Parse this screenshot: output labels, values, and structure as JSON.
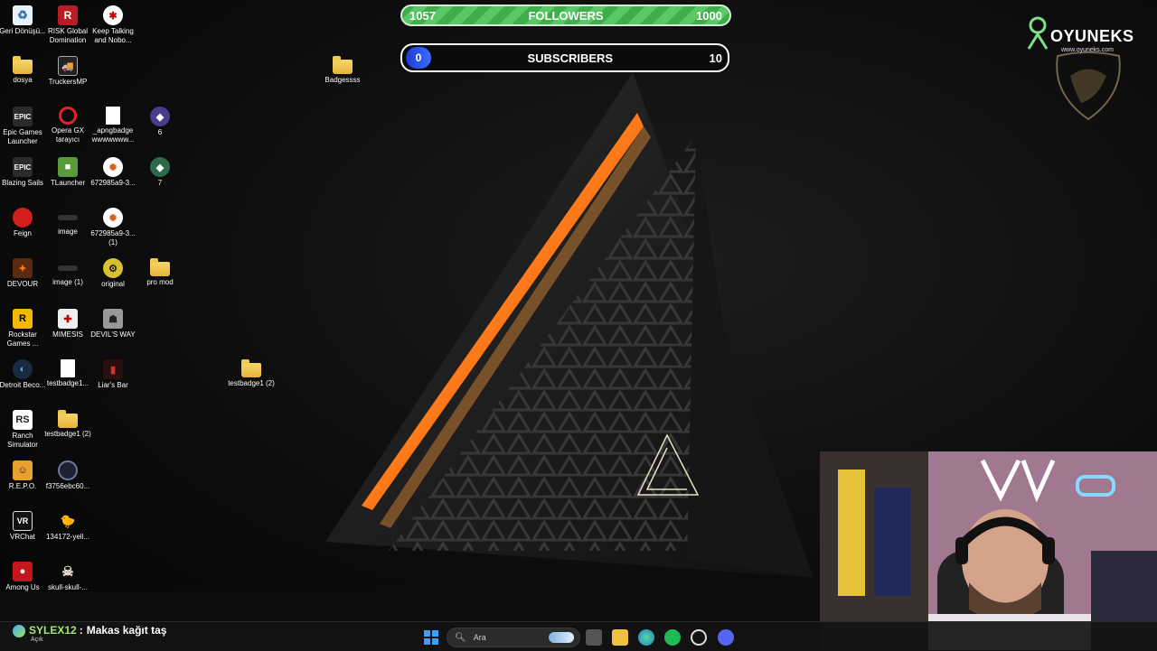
{
  "stream": {
    "followers": {
      "current": "1057",
      "label": "FOLLOWERS",
      "goal": "1000",
      "progress": 1.0,
      "color": "#4fbf5a"
    },
    "subscribers": {
      "current": "0",
      "label": "SUBSCRIBERS",
      "goal": "10",
      "progress": 0.0,
      "color": "#2a50f0"
    }
  },
  "brand": {
    "name": "OYUNEKS",
    "url": "www.oyuneks.com"
  },
  "desktop": {
    "icons": [
      {
        "label": "Geri Dönüşü...",
        "icon": "recycle-bin-icon"
      },
      {
        "label": "RISK Global Domination",
        "icon": "risk-icon"
      },
      {
        "label": "Keep Talking and Nobo...",
        "icon": "ktane-icon"
      },
      {
        "label": "dosya",
        "icon": "folder-icon"
      },
      {
        "label": "TruckersMP",
        "icon": "truck-icon"
      },
      {
        "label": "Badgessss",
        "icon": "folder-icon"
      },
      {
        "label": "Epic Games Launcher",
        "icon": "epic-icon"
      },
      {
        "label": "Opera GX tarayıcı",
        "icon": "opera-icon"
      },
      {
        "label": "_apngbadge wwwwwww...",
        "icon": "file-icon"
      },
      {
        "label": "6",
        "icon": "badge-icon"
      },
      {
        "label": "Blazing Sails",
        "icon": "epic-icon"
      },
      {
        "label": "TLauncher",
        "icon": "minecraft-icon"
      },
      {
        "label": "672985a9-3...",
        "icon": "gear-icon"
      },
      {
        "label": "7",
        "icon": "badge-icon"
      },
      {
        "label": "Feign",
        "icon": "feign-icon"
      },
      {
        "label": "image",
        "icon": "image-icon"
      },
      {
        "label": "672985a9-3... (1)",
        "icon": "gear-icon"
      },
      {
        "label": "DEVOUR",
        "icon": "devour-icon"
      },
      {
        "label": "image (1)",
        "icon": "image-icon"
      },
      {
        "label": "original",
        "icon": "original-icon"
      },
      {
        "label": "pro mod",
        "icon": "folder-icon"
      },
      {
        "label": "Rockstar Games ...",
        "icon": "rockstar-icon"
      },
      {
        "label": "MIMESIS",
        "icon": "mimesis-icon"
      },
      {
        "label": "DEVIL'S WAY",
        "icon": "devil-icon"
      },
      {
        "label": "Detroit Beco...",
        "icon": "detroit-icon"
      },
      {
        "label": "testbadge1...",
        "icon": "file-icon"
      },
      {
        "label": "Liar's Bar",
        "icon": "liars-bar-icon"
      },
      {
        "label": "testbadge1 (2)",
        "icon": "folder-icon"
      },
      {
        "label": "Ranch Simulator",
        "icon": "ranch-icon"
      },
      {
        "label": "testbadge1 (2)",
        "icon": "folder-icon"
      },
      {
        "label": "R.E.P.O.",
        "icon": "repo-icon"
      },
      {
        "label": "f3756ebc60...",
        "icon": "image-icon"
      },
      {
        "label": "VRChat",
        "icon": "vrchat-icon"
      },
      {
        "label": "134172-yell...",
        "icon": "duck-icon"
      },
      {
        "label": "Among Us",
        "icon": "among-us-icon"
      },
      {
        "label": "skull-skull-...",
        "icon": "skull-icon"
      }
    ]
  },
  "chat": {
    "user": "SYLEX12",
    "separator": ":",
    "message": "Makas kağıt taş",
    "status": "Açık"
  },
  "taskbar": {
    "search_placeholder": "Ara",
    "apps": [
      "start-icon",
      "search-icon",
      "widgets-icon",
      "task-view-icon",
      "file-explorer-icon",
      "edge-icon",
      "spotify-icon",
      "app-icon",
      "discord-icon"
    ]
  }
}
